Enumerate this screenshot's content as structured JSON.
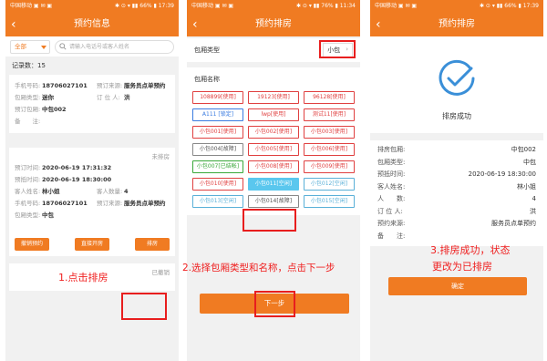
{
  "status_bar": {
    "p1": {
      "carrier": "中国移动 ▣ ✉ ▣",
      "right": "✱ ⊙ ▾ ▮▮ 66% ▮ 17:39"
    },
    "p2": {
      "carrier": "中国移动 ▣ ✉ ▣",
      "right": "✱ ⊙ ▾ ▮▮ 76% ▮ 11:34"
    },
    "p3": {
      "carrier": "中国移动 ▣ ✉ ▣",
      "right": "✱ ⊙ ▾ ▮▮ 66% ▮ 17:39"
    }
  },
  "screen1": {
    "title": "预约信息",
    "back": "‹",
    "filter_value": "全部",
    "search_placeholder": "请输入电话号或客人姓名",
    "record_count": "记录数：15",
    "card1": {
      "phone_label": "手机号码:",
      "phone": "18706027101",
      "source_label": "预订来源:",
      "source": "服务员点单预约",
      "type_label": "包厢类型:",
      "type": "迷你",
      "booker_label": "订 位 人:",
      "booker": "洪",
      "room_label": "预订包厢:",
      "room": "中包002",
      "remark_label": "备　　注:",
      "remark": ""
    },
    "card2": {
      "status": "未排房",
      "time_label": "预订时间:",
      "time": "2020-06-19 17:31:32",
      "arrive_label": "预抵时间:",
      "arrive": "2020-06-19 18:30:00",
      "name_label": "客人姓名:",
      "name": "林小姐",
      "num_label": "客人数量:",
      "num": "4",
      "phone_label": "手机号码:",
      "phone": "18706027101",
      "source_label": "预订来源:",
      "source": "服务员点单预约",
      "type_label": "包厢类型:",
      "type": "中包",
      "cancel_btn": "撤销预约",
      "open_btn": "直接开房",
      "arrange_btn": "排房"
    },
    "card3_status": "已撤销",
    "annotation": "1.点击排房"
  },
  "screen2": {
    "title": "预约排房",
    "back": "‹",
    "type_label": "包厢类型",
    "type_value": "小包",
    "name_label": "包厢名称",
    "rooms": [
      {
        "label": "108899[使用]",
        "state": "used"
      },
      {
        "label": "19123[使用]",
        "state": "used"
      },
      {
        "label": "96128[使用]",
        "state": "used"
      },
      {
        "label": "A111 [锁定]",
        "state": "locked"
      },
      {
        "label": "lwp[使用]",
        "state": "used"
      },
      {
        "label": "测试11[使用]",
        "state": "used"
      },
      {
        "label": "小包001[使用]",
        "state": "used"
      },
      {
        "label": "小包002[使用]",
        "state": "used"
      },
      {
        "label": "小包003[使用]",
        "state": "used"
      },
      {
        "label": "小包004[故障]",
        "state": "closed"
      },
      {
        "label": "小包005[使用]",
        "state": "used"
      },
      {
        "label": "小包006[使用]",
        "state": "used"
      },
      {
        "label": "小包007[已结帐]",
        "state": "done"
      },
      {
        "label": "小包008[使用]",
        "state": "used"
      },
      {
        "label": "小包009[使用]",
        "state": "used"
      },
      {
        "label": "小包010[使用]",
        "state": "used"
      },
      {
        "label": "小包011[空闲]",
        "state": "selected"
      },
      {
        "label": "小包012[空闲]",
        "state": "free"
      },
      {
        "label": "小包013[空闲]",
        "state": "free"
      },
      {
        "label": "小包014[故障]",
        "state": "closed"
      },
      {
        "label": "小包015[空闲]",
        "state": "free"
      }
    ],
    "next_btn": "下一步",
    "annotation": "2.选择包厢类型和名称，点击下一步"
  },
  "screen3": {
    "title": "预约排房",
    "back": "‹",
    "success_text": "排房成功",
    "info": [
      {
        "k": "排房包厢:",
        "v": "中包002"
      },
      {
        "k": "包厢类型:",
        "v": "中包"
      },
      {
        "k": "预抵时间:",
        "v": "2020-06-19 18:30:00"
      },
      {
        "k": "客人姓名:",
        "v": "林小姐"
      },
      {
        "k": "人　　数:",
        "v": "4"
      },
      {
        "k": "订 位 人:",
        "v": "洪"
      },
      {
        "k": "预约来源:",
        "v": "服务员点单预约"
      },
      {
        "k": "备　　注:",
        "v": ""
      }
    ],
    "ok_btn": "确定",
    "annotation_line1": "3.排房成功，状态",
    "annotation_line2": "更改为已排房"
  },
  "colors": {
    "accent": "#f07b22",
    "annotation": "#f02020",
    "used": "#e04040",
    "free": "#5ab0d8",
    "selected": "#5ac7ee",
    "locked": "#3a7be0",
    "done": "#3aa83a",
    "check": "#3a8fd8"
  }
}
